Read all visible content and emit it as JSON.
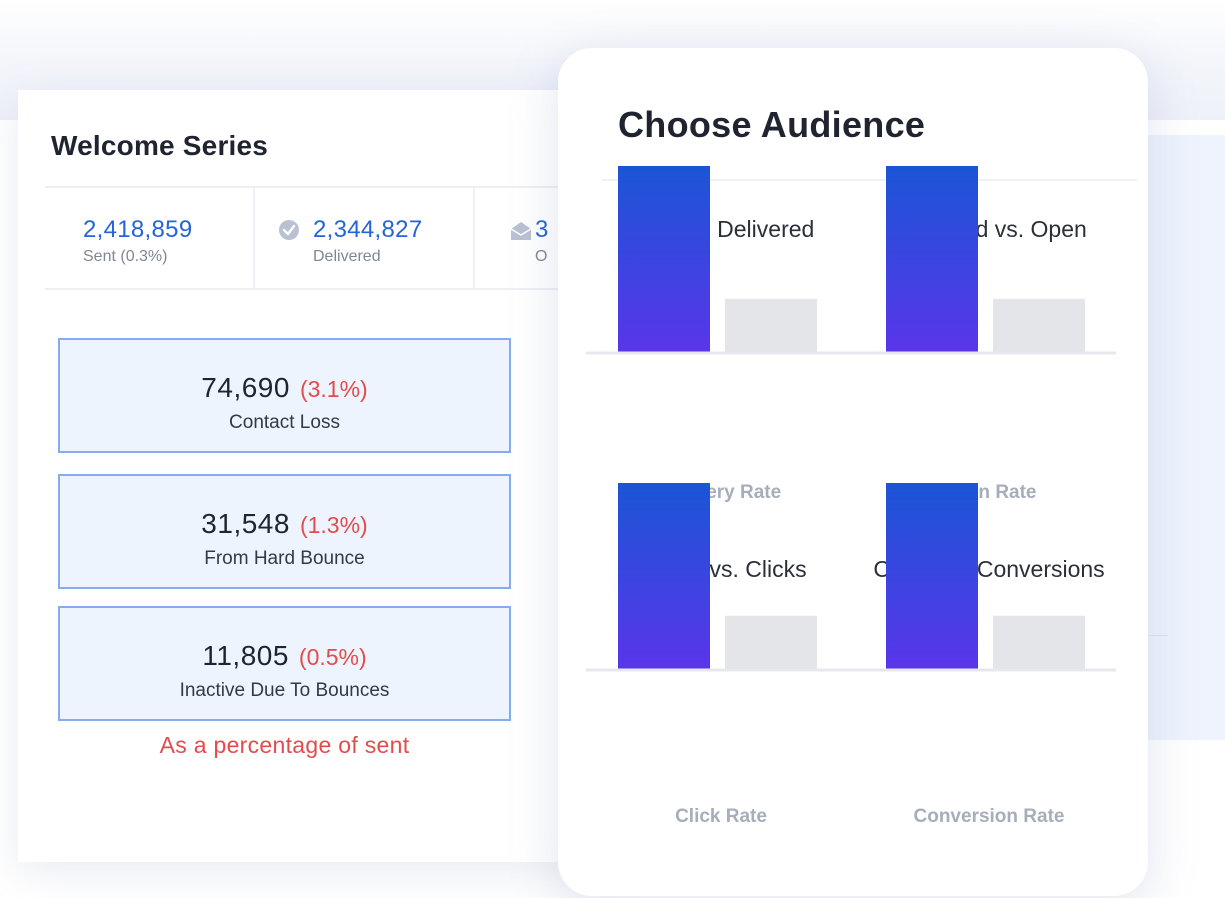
{
  "campaign": {
    "title": "Welcome Series",
    "stats": [
      {
        "value": "2,418,859",
        "label": "Sent (0.3%)"
      },
      {
        "value": "2,344,827",
        "label": "Delivered",
        "icon": "check-circle-icon"
      },
      {
        "value": "3",
        "label": "O",
        "icon": "envelope-open-icon"
      }
    ],
    "losses": [
      {
        "value": "74,690",
        "pct": "(3.1%)",
        "label": "Contact Loss"
      },
      {
        "value": "31,548",
        "pct": "(1.3%)",
        "label": "From Hard Bounce"
      },
      {
        "value": "11,805",
        "pct": "(0.5%)",
        "label": "Inactive Due To Bounces"
      }
    ],
    "footnote": "As a percentage of sent"
  },
  "audience": {
    "title": "Choose Audience"
  },
  "colors": {
    "accent_blue": "#2563d9",
    "loss_red": "#e24c4c",
    "box_fill": "#eef4fd",
    "box_border": "#86acef",
    "bar_gradient_top": "#1b55d6",
    "bar_gradient_bottom": "#5a35ea",
    "bar_secondary": "#e3e5e9"
  },
  "chart_data": [
    {
      "type": "bar",
      "title": "Sent vs. Delivered",
      "xlabel": "Delivery Rate",
      "values": [
        1.0,
        0.29
      ],
      "ylim": [
        0,
        1
      ]
    },
    {
      "type": "bar",
      "title": "Delivered vs. Open",
      "xlabel": "Open Rate",
      "values": [
        1.0,
        0.29
      ],
      "ylim": [
        0,
        1
      ]
    },
    {
      "type": "bar",
      "title": "Opens vs. Clicks",
      "xlabel": "Click Rate",
      "values": [
        1.0,
        0.29
      ],
      "ylim": [
        0,
        1
      ]
    },
    {
      "type": "bar",
      "title": "Clicks vs. Conversions",
      "xlabel": "Conversion Rate",
      "values": [
        1.0,
        0.29
      ],
      "ylim": [
        0,
        1
      ]
    }
  ]
}
